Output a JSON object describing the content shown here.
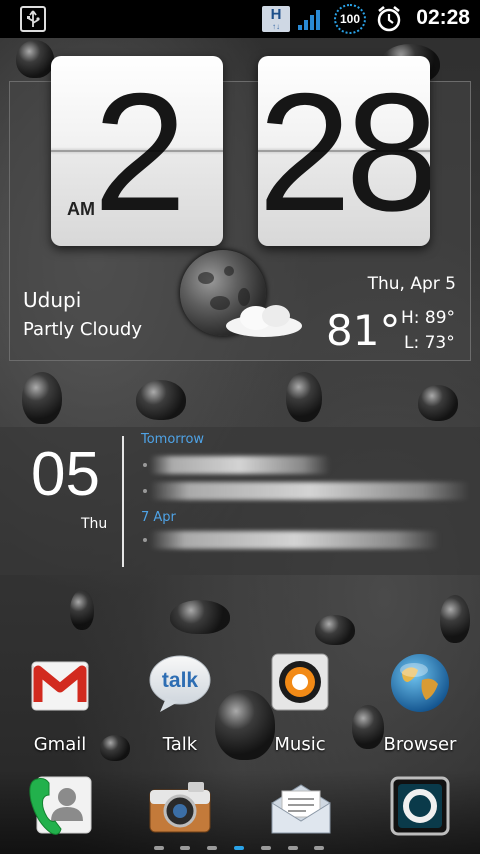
{
  "status_bar": {
    "time": "02:28",
    "battery_level": "100",
    "network_badge": "H",
    "network_arrows": "↑↓",
    "icons": [
      "usb-icon",
      "hspa-icon",
      "signal-icon",
      "battery-icon",
      "alarm-icon"
    ]
  },
  "clock_widget": {
    "hour": "2",
    "minute": "28",
    "ampm": "AM"
  },
  "weather": {
    "city": "Udupi",
    "condition": "Partly Cloudy",
    "date": "Thu, Apr 5",
    "temperature": "81°",
    "high": "H:   89°",
    "low": "L:   73°",
    "icon": "moon-cloud-icon"
  },
  "calendar_widget": {
    "day_number": "05",
    "day_name": "Thu",
    "sections": [
      {
        "heading": "Tomorrow"
      },
      {
        "heading": "7 Apr"
      }
    ]
  },
  "apps": [
    {
      "label": "Gmail",
      "icon": "gmail-icon"
    },
    {
      "label": "Talk",
      "icon": "talk-icon"
    },
    {
      "label": "Music",
      "icon": "music-icon"
    },
    {
      "label": "Browser",
      "icon": "browser-icon"
    }
  ],
  "talk_icon_text": "talk",
  "dock": [
    "phone-icon",
    "camera-icon",
    "messages-icon",
    "camera-lens-icon"
  ],
  "page_indicator": {
    "count": 7,
    "active": 3
  },
  "colors": {
    "accent": "#2aa3e8",
    "calendar_heading": "#4fa3e6",
    "signal": "#2a8ad4"
  }
}
